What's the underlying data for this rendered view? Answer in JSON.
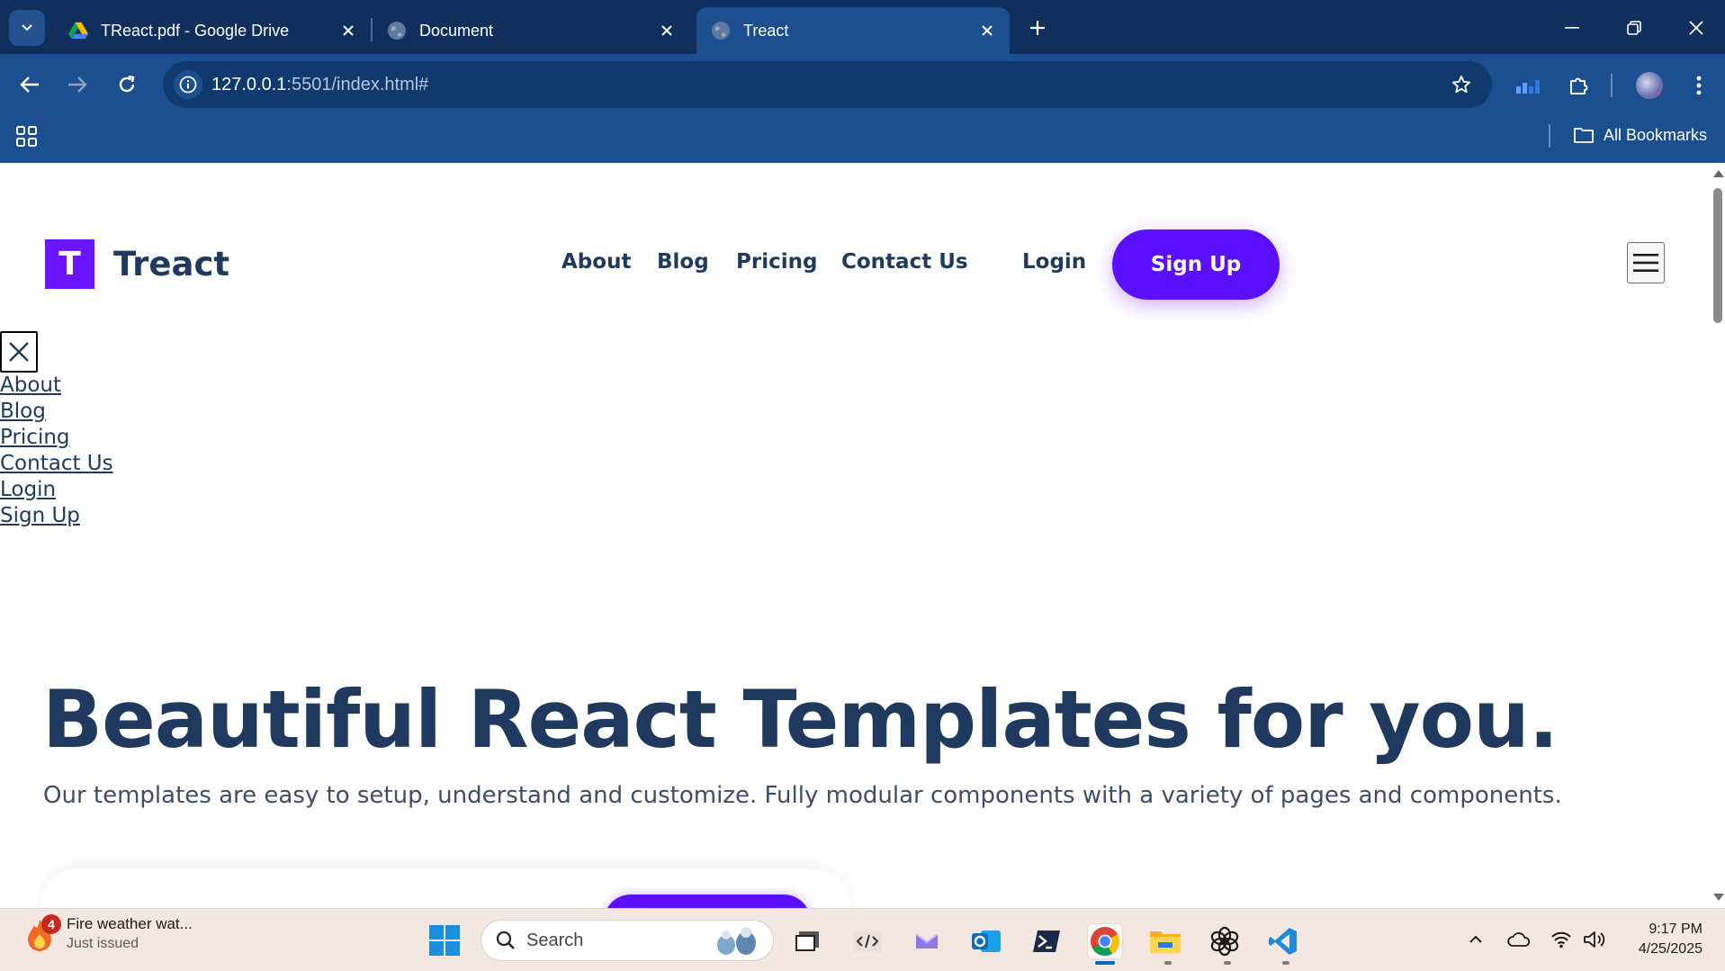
{
  "browser": {
    "tabs": [
      {
        "title": "TReact.pdf - Google Drive",
        "icon": "google-drive-icon",
        "active": false
      },
      {
        "title": "Document",
        "icon": "globe-icon",
        "active": false
      },
      {
        "title": "Treact",
        "icon": "globe-icon",
        "active": true
      }
    ],
    "url_host": "127.0.0.1",
    "url_path": ":5501/index.html#",
    "bookmarks_label": "All Bookmarks"
  },
  "site": {
    "logo_letter": "T",
    "logo_text": "Treact",
    "nav": {
      "about": "About",
      "blog": "Blog",
      "pricing": "Pricing",
      "contact": "Contact Us",
      "login": "Login",
      "signup": "Sign Up"
    },
    "mobile_menu": [
      "About",
      "Blog",
      "Pricing",
      "Contact Us",
      "Login",
      "Sign Up"
    ],
    "hero": {
      "title": "Beautiful React Templates for you.",
      "subtitle": "Our templates are easy to setup, understand and customize. Fully modular components with a variety of pages and components."
    },
    "colors": {
      "primary": "#5a10ff",
      "heading": "#1f3a5e"
    }
  },
  "taskbar": {
    "weather_title": "Fire weather wat...",
    "weather_sub": "Just issued",
    "weather_badge": "4",
    "search_label": "Search",
    "time": "9:17 PM",
    "date": "4/25/2025"
  }
}
